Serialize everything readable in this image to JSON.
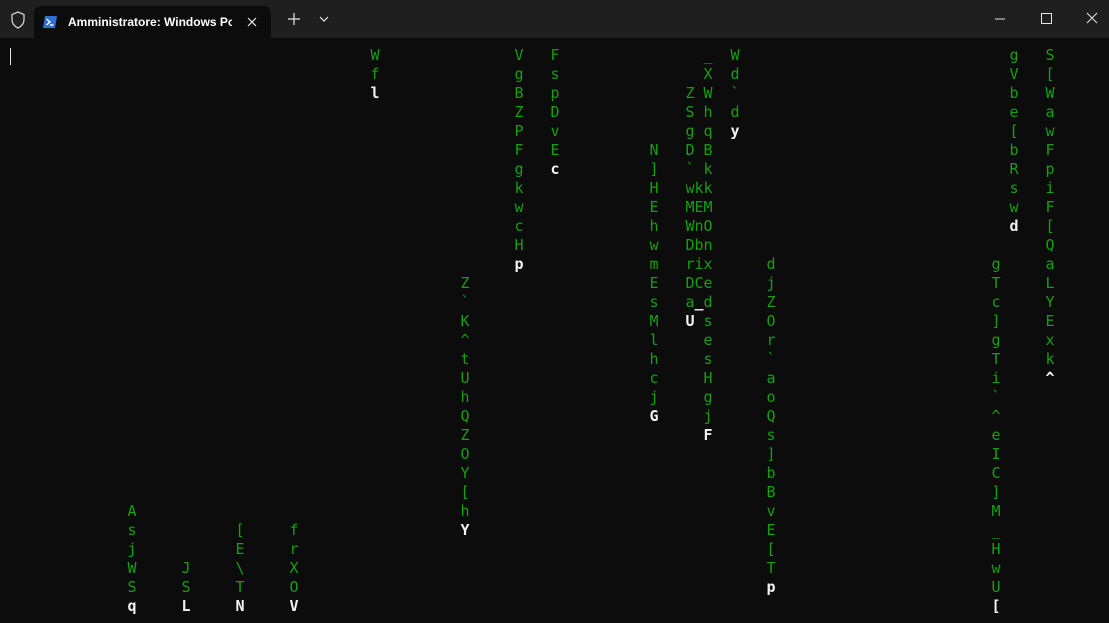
{
  "window": {
    "tab_title": "Amministratore: Windows PowerShell",
    "icons": [
      "shield-icon",
      "powershell-icon",
      "close-icon",
      "plus-icon",
      "chevron-down-icon",
      "minimize-icon",
      "maximize-icon",
      "close-icon"
    ]
  },
  "colors": {
    "background": "#0c0c0c",
    "titlebar": "#1f1f1f",
    "trail": "#13a10e",
    "head": "#f2f2f2"
  },
  "rain": [
    {
      "chars": [
        "A",
        "s",
        "j",
        "W",
        "S",
        "q"
      ]
    },
    {
      "chars": [
        "J",
        "S",
        "L"
      ]
    },
    {
      "chars": [
        "[",
        "E",
        "\\",
        "T",
        "N"
      ]
    },
    {
      "chars": [
        "f",
        "r",
        "X",
        "O",
        "V"
      ]
    },
    {
      "chars": [
        "W",
        "f",
        "l"
      ]
    },
    {
      "chars": [
        "Z",
        "`",
        "K",
        "^",
        "t",
        "U",
        "h",
        "Q",
        "Z",
        "O",
        "Y",
        "[",
        "h",
        "Y"
      ]
    },
    {
      "chars": [
        "V",
        "g",
        "B",
        "Z",
        "P",
        "F",
        "g",
        "k",
        "w",
        "c",
        "H",
        "p"
      ]
    },
    {
      "chars": [
        "F",
        "s",
        "p",
        "D",
        "v",
        "E",
        "c"
      ]
    },
    {
      "chars": [
        "N",
        "]",
        "H",
        "E",
        "h",
        "w",
        "m",
        "E",
        "s",
        "M",
        "l",
        "h",
        "c",
        "j",
        "G"
      ]
    },
    {
      "chars": [
        "Z",
        "S",
        "g",
        "D",
        "`",
        "w",
        "M",
        "W",
        "D",
        "r",
        "D",
        "a",
        "U"
      ]
    },
    {
      "chars": [
        "k",
        "E",
        "n",
        "b",
        "i",
        "C",
        "_"
      ]
    },
    {
      "chars": [
        "_",
        "X",
        "W",
        "h",
        "q",
        "B",
        "k",
        "k",
        "M",
        "O",
        "n",
        "x",
        "e",
        "d",
        "s",
        "e",
        "s",
        "H",
        "g",
        "j",
        "F"
      ]
    },
    {
      "chars": [
        "W",
        "d",
        "`",
        "d",
        "y"
      ]
    },
    {
      "chars": [
        "d",
        "j",
        "Z",
        "O",
        "r",
        "`",
        "a",
        "o",
        "Q",
        "s",
        "]",
        "b",
        "B",
        "v",
        "E",
        "[",
        "T",
        "p"
      ]
    },
    {
      "chars": [
        "g",
        "T",
        "c",
        "]",
        "g",
        "T",
        "i",
        "`",
        "^",
        "e",
        "I",
        "C",
        "]",
        "M",
        "_",
        "H",
        "w",
        "U",
        "["
      ]
    },
    {
      "chars": [
        "g",
        "V",
        "b",
        "e",
        "[",
        "b",
        "R",
        "s",
        "w",
        "d"
      ]
    },
    {
      "chars": [
        "S",
        "[",
        "W",
        "a",
        "w",
        "F",
        "p",
        "i",
        "F",
        "[",
        "Q",
        "a",
        "L",
        "Y",
        "E",
        "x",
        "k",
        "^"
      ]
    }
  ]
}
